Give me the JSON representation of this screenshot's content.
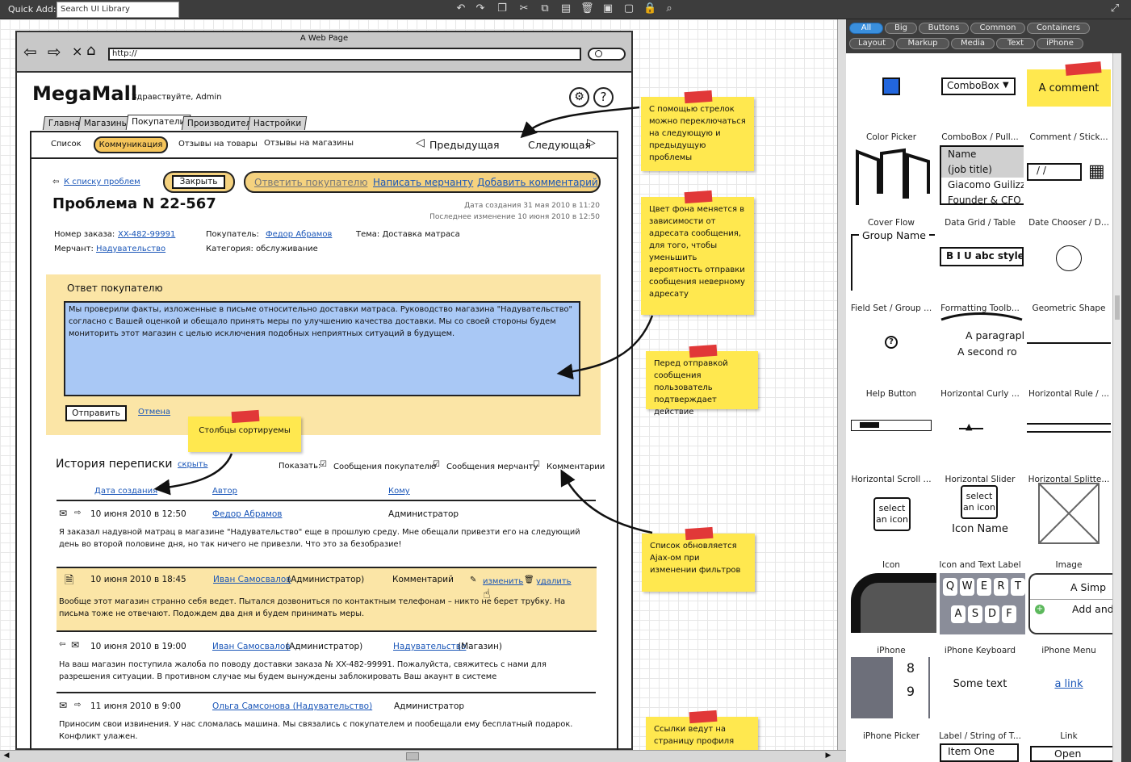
{
  "toolbar": {
    "quick_add_label": "Quick Add:",
    "search_placeholder": "Search UI Library"
  },
  "library": {
    "filters": [
      "All",
      "Big",
      "Buttons",
      "Common",
      "Containers",
      "Layout",
      "Markup",
      "Media",
      "Text",
      "iPhone"
    ],
    "active_filter": "All",
    "items": [
      "Color Picker",
      "ComboBox / Pull...",
      "Comment / Stick...",
      "Cover Flow",
      "Data Grid / Table",
      "Date Chooser / D...",
      "Field Set / Group ...",
      "Formatting Toolb...",
      "Geometric Shape",
      "Help Button",
      "Horizontal Curly ...",
      "Horizontal Rule / ...",
      "Horizontal Scroll ...",
      "Horizontal Slider",
      "Horizontal Splitte...",
      "Icon",
      "Icon and Text Label",
      "Image",
      "iPhone",
      "iPhone Keyboard",
      "iPhone Menu",
      "iPhone Picker",
      "Label / String of T...",
      "Link"
    ],
    "previews": {
      "combobox": "ComboBox",
      "comment": "A comment",
      "grid_rows": [
        "Name",
        "(job title)",
        "Giacomo Guilizz",
        "Founder & CFO"
      ],
      "date": "/ /",
      "fieldset": "Group Name",
      "fmt": "B I U abc style",
      "para": [
        "A paragrapl",
        "A second ro"
      ],
      "icon_text": "select an icon",
      "icon_name": "Icon Name",
      "kb_row1": [
        "Q",
        "W",
        "E",
        "R",
        "T"
      ],
      "kb_row2": [
        "A",
        "S",
        "D",
        "F"
      ],
      "menu": [
        "A Simp",
        "Add and"
      ],
      "picker": [
        "8",
        "9"
      ],
      "label": "Some text",
      "link": "a link",
      "bottom": [
        "Item One",
        "Open"
      ]
    }
  },
  "page": {
    "window_title": "A Web Page",
    "url": "http://",
    "brand": "MegaMall",
    "greeting": "Здравствуйте, Admin",
    "tabs": [
      "Главная",
      "Магазины",
      "Покупатели",
      "Производители",
      "Настройки"
    ],
    "subnav": [
      "Список",
      "Коммуникация",
      "Отзывы на товары",
      "Отзывы на магазины"
    ],
    "prev": "Предыдущая",
    "next": "Следующая",
    "back_link": "К списку проблем",
    "close_btn": "Закрыть",
    "actions": [
      "Ответить покупателю",
      "Написать мерчанту",
      "Добавить комментарий"
    ],
    "title": "Проблема N 22-567",
    "created": "Дата создания 31 мая 2010 в 11:20",
    "modified": "Последнее изменение 10 июня 2010 в 12:50",
    "order_label": "Номер заказа:",
    "order_value": "XX-482-99991",
    "buyer_label": "Покупатель:",
    "buyer_value": "Федор Абрамов",
    "topic": "Тема: Доставка матраса",
    "merchant_label": "Мерчант:",
    "merchant_value": "Надувательство",
    "category": "Категория: обслуживание",
    "reply_title": "Ответ покупателю",
    "reply_text": "Мы проверили факты, изложенные в письме относительно доставки матраса. Руководство магазина \"Надувательство\" согласно с Вашей оценкой и обещало принять меры по улучшению качества доставки. Мы со своей стороны будем мониторить этот магазин с целью исключения подобных неприятных ситуаций в будущем.",
    "send": "Отправить",
    "cancel": "Отмена",
    "history_title": "История переписки",
    "hide": "скрыть",
    "show": "Показать:",
    "filters": [
      "Сообщения покупателю",
      "Сообщения мерчанту",
      "Комментарии"
    ],
    "cols": [
      "Дата создания",
      "Автор",
      "Кому"
    ],
    "messages": [
      {
        "date": "10 июня 2010 в 12:50",
        "author": "Федор Абрамов",
        "to": "Администратор",
        "text": "Я заказал надувной матрац в магазине \"Надувательство\" еще в прошлую среду. Мне обещали привезти его на следующий день во второй половине дня, но так ничего не привезли. Что это за безобразие!"
      },
      {
        "date": "10 июня 2010 в 18:45",
        "author": "Иван Самосвалов",
        "role": "(Администратор)",
        "to": "Комментарий",
        "edit": "изменить",
        "del": "удалить",
        "text": "Вообще этот магазин странно себя ведет. Пытался дозвониться по контактным телефонам – никто не берет трубку. На письма тоже не отвечают. Подождем два дня и будем принимать меры."
      },
      {
        "date": "10 июня 2010 в 19:00",
        "author": "Иван Самосвалов",
        "role": "(Администратор)",
        "to": "Надувательство",
        "to_role": "(Магазин)",
        "text": "На ваш магазин поступила жалоба по поводу доставки заказа № XX-482-99991. Пожалуйста, свяжитесь с нами для разрешения ситуации. В противном случае мы будем вынуждены заблокировать Ваш акаунт в системе"
      },
      {
        "date": "11 июня 2010 в 9:00",
        "author": "Ольга Самсонова (Надувательство)",
        "to": "Администратор",
        "text": "Приносим свои извинения. У нас сломалась машина. Мы связались с покупателем и пообещали ему бесплатный подарок. Конфликт улажен."
      }
    ]
  },
  "notes": [
    "С помощью стрелок можно переключаться на следующую и предыдущую проблемы",
    "Цвет фона меняется в зависимости от адресата сообщения, для того, чтобы уменьшить вероятность отправки сообщения неверному адресату",
    "Перед отправкой сообщения пользователь подтверждает действие",
    "Столбцы сортируемы",
    "Список обновляется Ajax-ом при изменении фильтров",
    "Ссылки ведут на страницу профиля"
  ],
  "icons": [
    "undo-icon",
    "redo-icon",
    "copy-icon",
    "cut-icon",
    "duplicate-icon",
    "paste-icon",
    "delete-icon",
    "bring-front-icon",
    "send-back-icon",
    "lock-icon",
    "zoom-icon",
    "fullscreen-icon"
  ]
}
